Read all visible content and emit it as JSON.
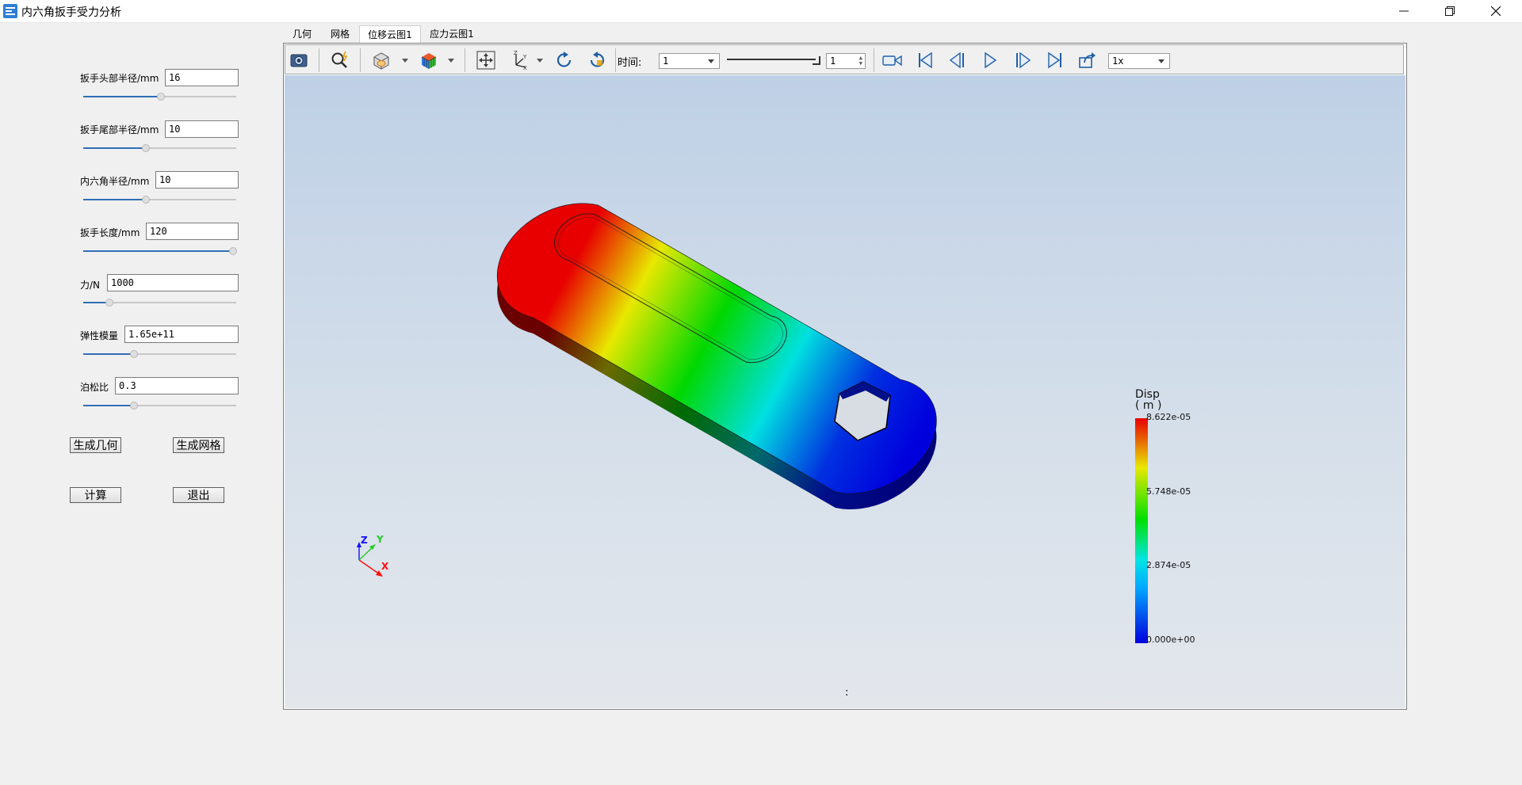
{
  "window": {
    "title": "内六角扳手受力分析"
  },
  "params": [
    {
      "label": "扳手头部半径/mm",
      "value": "16",
      "slider": 0.51
    },
    {
      "label": "扳手尾部半径/mm",
      "value": "10",
      "slider": 0.41
    },
    {
      "label": "内六角半径/mm",
      "value": "10",
      "slider": 0.41
    },
    {
      "label": "扳手长度/mm",
      "value": "120",
      "slider": 0.98
    },
    {
      "label": "力/N",
      "value": "1000",
      "slider": 0.17
    },
    {
      "label": "弹性模量",
      "value": "1.65e+11",
      "slider": 0.33
    },
    {
      "label": "泊松比",
      "value": "0.3",
      "slider": 0.33
    }
  ],
  "buttons": {
    "gen_geom": "生成几何",
    "gen_mesh": "生成网格",
    "compute": "计算",
    "exit": "退出"
  },
  "tabs": [
    "几何",
    "网格",
    "位移云图1",
    "应力云图1"
  ],
  "active_tab": "位移云图1",
  "toolbar": {
    "time_label": "时间:",
    "time_value": "1",
    "frame_value": "1",
    "speed_value": "1x"
  },
  "viewport": {
    "bottom_label": ":",
    "axes": {
      "x": "X",
      "y": "Y",
      "z": "Z"
    }
  },
  "legend": {
    "title": "Disp",
    "unit": "( m )",
    "ticks": [
      "8.622e-05",
      "5.748e-05",
      "2.874e-05",
      "0.000e+00"
    ]
  },
  "colors": {
    "scale": [
      "#0000dd",
      "#00e5e5",
      "#00e000",
      "#e8e800",
      "#e80000"
    ],
    "accent": "#2f6fb6"
  }
}
